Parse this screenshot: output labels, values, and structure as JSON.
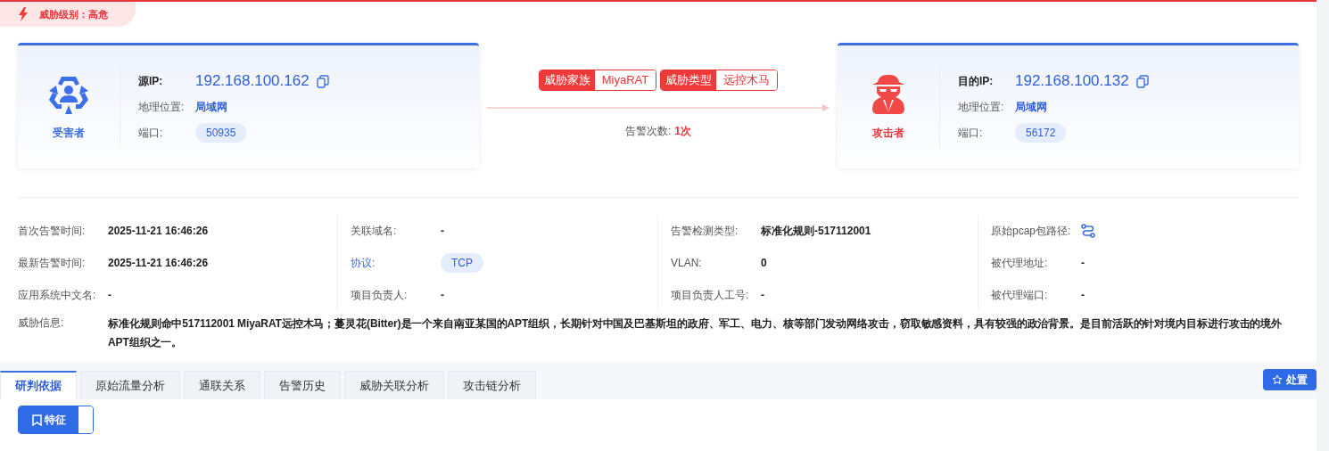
{
  "threat_level": {
    "text": "威胁级别：高危"
  },
  "victim": {
    "role": "受害者",
    "ip_label": "源IP:",
    "ip": "192.168.100.162",
    "geo_label": "地理位置:",
    "geo": "局域网",
    "port_label": "端口:",
    "port": "50935"
  },
  "link": {
    "tags": [
      {
        "label": "威胁家族",
        "value": "MiyaRAT"
      },
      {
        "label": "威胁类型",
        "value": "远控木马"
      }
    ],
    "count_label": "告警次数:",
    "count": "1次"
  },
  "attacker": {
    "role": "攻击者",
    "ip_label": "目的IP:",
    "ip": "192.168.100.132",
    "geo_label": "地理位置:",
    "geo": "局域网",
    "port_label": "端口:",
    "port": "56172"
  },
  "info_columns": [
    [
      {
        "label": "首次告警时间:",
        "value": "2025-11-21 16:46:26",
        "kind": "text"
      },
      {
        "label": "最新告警时间:",
        "value": "2025-11-21 16:46:26",
        "kind": "text"
      },
      {
        "label": "应用系统中文名:",
        "value": "-",
        "kind": "text"
      }
    ],
    [
      {
        "label": "关联域名:",
        "value": "-",
        "kind": "text"
      },
      {
        "label": "协议:",
        "value": "TCP",
        "kind": "tag"
      },
      {
        "label": "项目负责人:",
        "value": "-",
        "kind": "text"
      }
    ],
    [
      {
        "label": "告警检测类型:",
        "value": "标准化规则-517112001",
        "kind": "text"
      },
      {
        "label": "VLAN:",
        "value": "0",
        "kind": "text"
      },
      {
        "label": "项目负责人工号:",
        "value": "-",
        "kind": "text"
      }
    ],
    [
      {
        "label": "原始pcap包路径:",
        "kind": "path-icon"
      },
      {
        "label": "被代理地址:",
        "value": "-",
        "kind": "text"
      },
      {
        "label": "被代理端口:",
        "value": "-",
        "kind": "text"
      }
    ]
  ],
  "threat_info": {
    "label": "威胁信息:",
    "text": "标准化规则命中517112001 MiyaRAT远控木马；蔓灵花(Bitter)是一个来自南亚某国的APT组织，长期针对中国及巴基斯坦的政府、军工、电力、核等部门发动网络攻击，窃取敏感资料，具有较强的政治背景。是目前活跃的针对境内目标进行攻击的境外APT组织之一。"
  },
  "tabs": [
    {
      "label": "研判依据",
      "selected": true
    },
    {
      "label": "原始流量分析",
      "selected": false
    },
    {
      "label": "通联关系",
      "selected": false
    },
    {
      "label": "告警历史",
      "selected": false
    },
    {
      "label": "威胁关联分析",
      "selected": false
    },
    {
      "label": "攻击链分析",
      "selected": false
    }
  ],
  "action_button": {
    "label": "处置"
  },
  "view_toggle": [
    {
      "label": "特征",
      "selected": true
    },
    {
      "selected": false
    }
  ]
}
